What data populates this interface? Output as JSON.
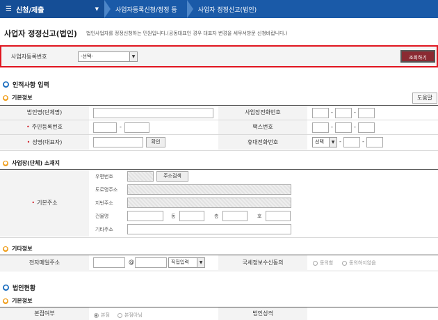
{
  "nav": {
    "menu_label": "신청/제출",
    "menu_icon": "hamburger-icon",
    "crumbs": [
      "사업자등록신청/정정 등",
      "사업자 정정신고(법인)"
    ]
  },
  "page": {
    "title": "사업자 정정신고(법인)",
    "description": "법인사업자를 정정신청하는 민원입니다.(공동대표인 경우 대표자 변경을 세무서방문 신청바랍니다.)"
  },
  "search": {
    "label": "사업자등록번호",
    "select_value": "-선택-",
    "button": "조회하기"
  },
  "sec_personal": {
    "title": "인적사항 입력",
    "sub_basic": "기본정보",
    "help_button": "도움말",
    "corp_name_label": "법인명(단체명)",
    "biz_phone_label": "사업장전화번호",
    "resident_label": "주민등록번호",
    "fax_label": "팩스번호",
    "name_label": "성명(대표자)",
    "confirm_button": "확인",
    "mobile_label": "휴대전화번호",
    "mobile_select": "선택"
  },
  "sec_address": {
    "title": "사업장(단체) 소재지",
    "basic_address_label": "기본주소",
    "postal_label": "우편번호",
    "postal_button": "주소검색",
    "road_label": "도로명주소",
    "lot_label": "지번주소",
    "building_label": "건물명",
    "dong_label": "동",
    "floor_label": "층",
    "ho_label": "호",
    "other_label": "기타주소"
  },
  "sec_other": {
    "title": "기타정보",
    "email_label": "전자메일주소",
    "at_sign": "@",
    "domain_select": "직접입력",
    "consent_label": "국세정보수신동의",
    "agree": "동의함",
    "disagree": "동의하지않음"
  },
  "sec_corp": {
    "title": "법인현황",
    "sub_basic": "기본정보",
    "hq_label": "본점여부",
    "hq_option": "본점",
    "non_hq_option": "본점아님",
    "corp_type_label": "법인성격"
  }
}
